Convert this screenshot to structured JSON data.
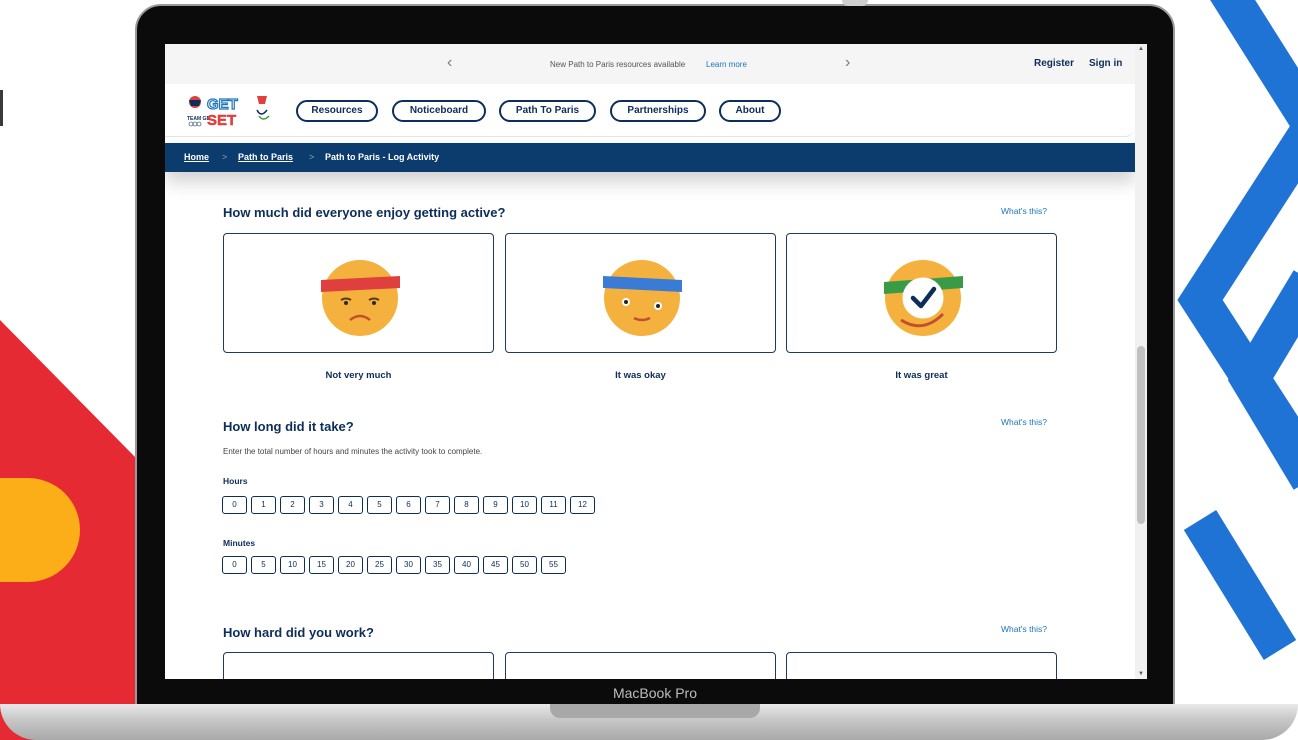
{
  "device": {
    "label": "MacBook Pro"
  },
  "topbar": {
    "prev_icon": "chevron-left",
    "next_icon": "chevron-right",
    "announcement": "New Path to Paris resources available",
    "learn_more": "Learn more",
    "register": "Register",
    "sign_in": "Sign in"
  },
  "header": {
    "logo_text": "GET SET",
    "logo_caption": "TEAM GB",
    "nav": [
      "Resources",
      "Noticeboard",
      "Path To Paris",
      "Partnerships",
      "About"
    ]
  },
  "breadcrumb": [
    "Home",
    "Path to Paris",
    "Path to Paris - Log Activity"
  ],
  "enjoyment": {
    "title": "How much did everyone enjoy getting active?",
    "whats_this": "What's this?",
    "options": [
      "Not very much",
      "It was okay",
      "It was great"
    ],
    "selected": "It was great"
  },
  "duration": {
    "title": "How long did it take?",
    "whats_this": "What's this?",
    "hint": "Enter the total number of hours and minutes the activity took to complete.",
    "hours_label": "Hours",
    "hours": [
      "0",
      "1",
      "2",
      "3",
      "4",
      "5",
      "6",
      "7",
      "8",
      "9",
      "10",
      "11",
      "12"
    ],
    "minutes_label": "Minutes",
    "minutes": [
      "0",
      "5",
      "10",
      "15",
      "20",
      "25",
      "30",
      "35",
      "40",
      "45",
      "50",
      "55"
    ]
  },
  "effort": {
    "title": "How hard did you work?",
    "whats_this": "What's this?"
  },
  "colors": {
    "navy": "#0d2d5a",
    "breadcrumb_bg": "#0c3b6e",
    "link": "#1c75bc",
    "face": "#f5b13d",
    "band_red": "#e0403d",
    "band_blue": "#3a7bd5",
    "band_green": "#3a9b46",
    "bg_red": "#e62a34",
    "bg_yellow": "#fbae17",
    "bg_blue": "#1f73d4"
  }
}
